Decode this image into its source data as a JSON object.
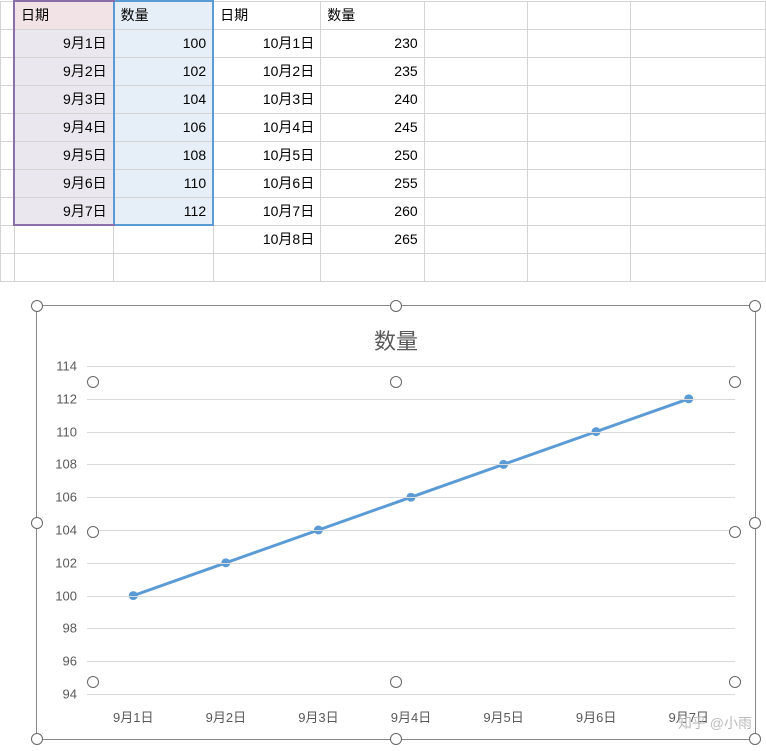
{
  "columns": {
    "a_header": "日期",
    "b_header": "数量",
    "c_header": "日期",
    "d_header": "数量"
  },
  "table1": [
    {
      "date": "9月1日",
      "qty": "100"
    },
    {
      "date": "9月2日",
      "qty": "102"
    },
    {
      "date": "9月3日",
      "qty": "104"
    },
    {
      "date": "9月4日",
      "qty": "106"
    },
    {
      "date": "9月5日",
      "qty": "108"
    },
    {
      "date": "9月6日",
      "qty": "110"
    },
    {
      "date": "9月7日",
      "qty": "112"
    }
  ],
  "table2": [
    {
      "date": "10月1日",
      "qty": "230"
    },
    {
      "date": "10月2日",
      "qty": "235"
    },
    {
      "date": "10月3日",
      "qty": "240"
    },
    {
      "date": "10月4日",
      "qty": "245"
    },
    {
      "date": "10月5日",
      "qty": "250"
    },
    {
      "date": "10月6日",
      "qty": "255"
    },
    {
      "date": "10月7日",
      "qty": "260"
    },
    {
      "date": "10月8日",
      "qty": "265"
    }
  ],
  "chart_data": {
    "type": "line",
    "title": "数量",
    "categories": [
      "9月1日",
      "9月2日",
      "9月3日",
      "9月4日",
      "9月5日",
      "9月6日",
      "9月7日"
    ],
    "values": [
      100,
      102,
      104,
      106,
      108,
      110,
      112
    ],
    "ylim": [
      94,
      114
    ],
    "yticks": [
      94,
      96,
      98,
      100,
      102,
      104,
      106,
      108,
      110,
      112,
      114
    ],
    "xlabel": "",
    "ylabel": ""
  },
  "watermark": "知乎 @小雨"
}
